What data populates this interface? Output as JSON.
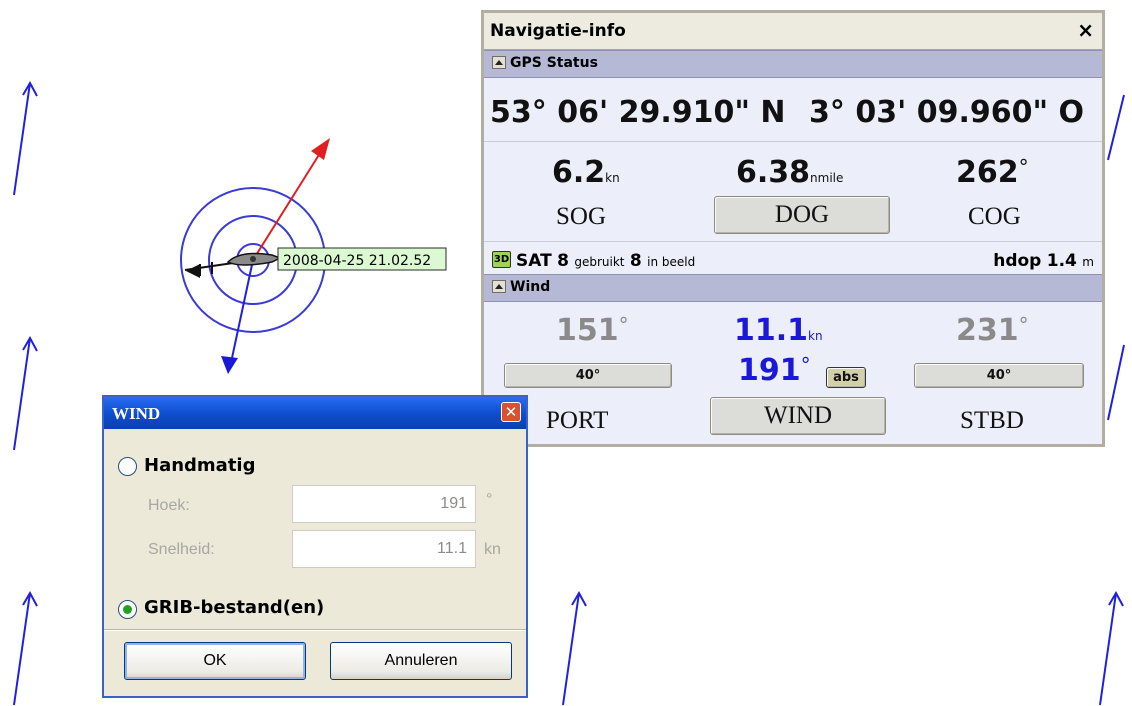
{
  "map": {
    "timestamp_label": "2008-04-25 21.02.52"
  },
  "nav_info": {
    "title": "Navigatie-info",
    "close_glyph": "×",
    "gps_section_label": "GPS Status",
    "latitude": "53° 06' 29.910\" N",
    "longitude": "3° 03' 09.960\" O",
    "sog": {
      "value": "6.2",
      "unit": "kn",
      "label": "SOG"
    },
    "dog": {
      "value": "6.38",
      "unit": "nmile",
      "label": "DOG"
    },
    "cog": {
      "value": "262",
      "unit": "°",
      "label": "COG"
    },
    "sat": {
      "badge": "3D",
      "prefix": "SAT",
      "used_count": "8",
      "used_text": "gebruikt",
      "view_count": "8",
      "view_text": "in beeld",
      "hdop_label": "hdop",
      "hdop_value": "1.4",
      "hdop_unit": "m"
    },
    "wind_section_label": "Wind",
    "port": {
      "angle": "151",
      "unit": "°",
      "button": "40°",
      "label": "PORT"
    },
    "wind": {
      "speed": "11.1",
      "speed_unit": "kn",
      "angle": "191",
      "angle_unit": "°",
      "mode_badge": "abs",
      "label": "WIND"
    },
    "stbd": {
      "angle": "231",
      "unit": "°",
      "button": "40°",
      "label": "STBD"
    },
    "colors": {
      "accent_blue": "#1a1ad6",
      "muted_gray": "#8a8a8a"
    }
  },
  "wind_dialog": {
    "title": "WIND",
    "close_glyph": "✕",
    "manual_label": "Handmatig",
    "manual_selected": false,
    "angle_label": "Hoek:",
    "angle_value": "191",
    "angle_unit": "°",
    "speed_label": "Snelheid:",
    "speed_value": "11.1",
    "speed_unit": "kn",
    "grib_label": "GRIB-bestand(en)",
    "grib_selected": true,
    "ok_label": "OK",
    "cancel_label": "Annuleren"
  }
}
